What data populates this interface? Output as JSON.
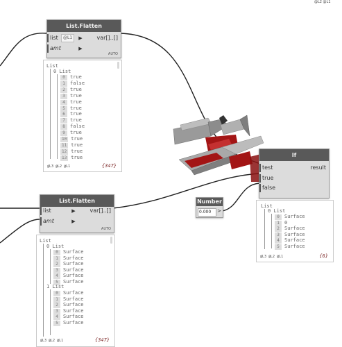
{
  "top_right_levels": "@L2 @L1",
  "node_flatten_1": {
    "title": "List.Flatten",
    "inputs": [
      {
        "label": "list",
        "chip": "@L1"
      },
      {
        "label": "amt"
      }
    ],
    "output": "var[]..[]",
    "lacing": "AUTO"
  },
  "watch_1": {
    "root": "List",
    "sub": "0 List",
    "items": [
      {
        "i": "0",
        "v": "true"
      },
      {
        "i": "1",
        "v": "false"
      },
      {
        "i": "2",
        "v": "true"
      },
      {
        "i": "3",
        "v": "true"
      },
      {
        "i": "4",
        "v": "true"
      },
      {
        "i": "5",
        "v": "true"
      },
      {
        "i": "6",
        "v": "true"
      },
      {
        "i": "7",
        "v": "true"
      },
      {
        "i": "8",
        "v": "false"
      },
      {
        "i": "9",
        "v": "true"
      },
      {
        "i": "10",
        "v": "true"
      },
      {
        "i": "11",
        "v": "true"
      },
      {
        "i": "12",
        "v": "true"
      },
      {
        "i": "13",
        "v": "true"
      }
    ],
    "levels": "@L3 @L2 @L1",
    "count": "{347}"
  },
  "node_if": {
    "title": "If",
    "inputs": [
      "test",
      "true",
      "false"
    ],
    "output": "result"
  },
  "watch_if": {
    "root": "List",
    "sub": "0 List",
    "items": [
      {
        "i": "0",
        "v": "Surface"
      },
      {
        "i": "1",
        "v": "0"
      },
      {
        "i": "2",
        "v": "Surface"
      },
      {
        "i": "3",
        "v": "Surface"
      },
      {
        "i": "4",
        "v": "Surface"
      },
      {
        "i": "5",
        "v": "Surface"
      }
    ],
    "levels": "@L3 @L2 @L1",
    "count": "{6}"
  },
  "node_number": {
    "title": "Number",
    "value": "0.000",
    "output_arrow": ">"
  },
  "node_flatten_2": {
    "title": "List.Flatten",
    "inputs": [
      {
        "label": "list"
      },
      {
        "label": "amt"
      }
    ],
    "output": "var[]..[]",
    "lacing": "AUTO"
  },
  "watch_2": {
    "root": "List",
    "sub0": "0 List",
    "items0": [
      {
        "i": "0",
        "v": "Surface"
      },
      {
        "i": "1",
        "v": "Surface"
      },
      {
        "i": "2",
        "v": "Surface"
      },
      {
        "i": "3",
        "v": "Surface"
      },
      {
        "i": "4",
        "v": "Surface"
      },
      {
        "i": "5",
        "v": "Surface"
      }
    ],
    "sub1": "1 List",
    "items1": [
      {
        "i": "0",
        "v": "Surface"
      },
      {
        "i": "1",
        "v": "Surface"
      },
      {
        "i": "2",
        "v": "Surface"
      },
      {
        "i": "3",
        "v": "Surface"
      },
      {
        "i": "4",
        "v": "Surface"
      },
      {
        "i": "5",
        "v": "Surface"
      }
    ],
    "levels": "@L3 @L2 @L1",
    "count": "{347}"
  },
  "colors": {
    "header": "#595959",
    "node_body": "#dcdcdc",
    "geometry_red": "#a31515",
    "count_text": "#7a2323"
  }
}
